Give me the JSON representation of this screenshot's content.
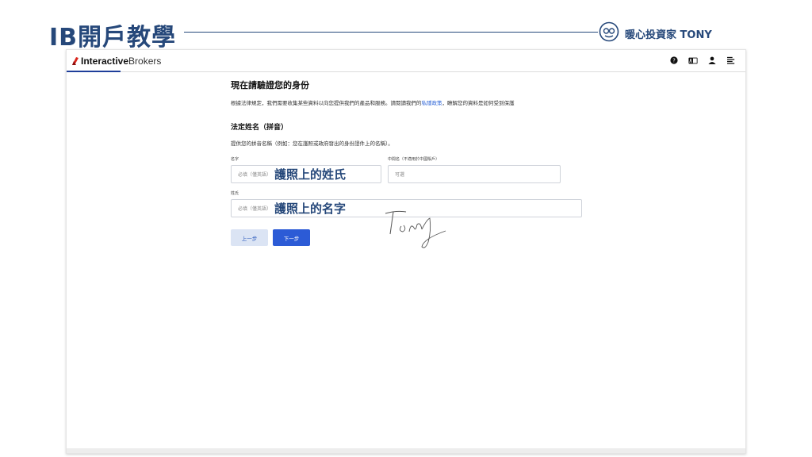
{
  "slide": {
    "title": "IB開戶教學",
    "brand": "暖心投資家 TONY"
  },
  "app": {
    "logo_bold": "Interactive",
    "logo_light": "Brokers",
    "icons": [
      "help-icon",
      "language-icon",
      "user-icon",
      "menu-icon"
    ]
  },
  "form": {
    "heading": "現在請驗證您的身份",
    "description_before": "根據法律規定，我們需要收集某些資料以向您提供我們的產品和服務。請閱讀我們的",
    "description_link": "私隱政策",
    "description_after": "，瞭解您的資料是如何受到保護",
    "section_title": "法定姓名（拼音）",
    "section_desc": "提供您的拼音名稱（例如：您在護照或政府發出的身份證件上的名稱）。",
    "first_name": {
      "label": "名字",
      "placeholder": "必填（僅英語）",
      "annotation": "護照上的姓氏"
    },
    "middle_name": {
      "label": "中間名（不適用於中國賬戶）",
      "placeholder": "可選"
    },
    "last_name": {
      "label": "姓氏",
      "placeholder": "必填（僅英語）",
      "annotation": "護照上的名字"
    },
    "back_label": "上一步",
    "next_label": "下一步"
  },
  "colors": {
    "slide_accent": "#26487a",
    "primary": "#2c5bd6",
    "link": "#2c63d6"
  }
}
